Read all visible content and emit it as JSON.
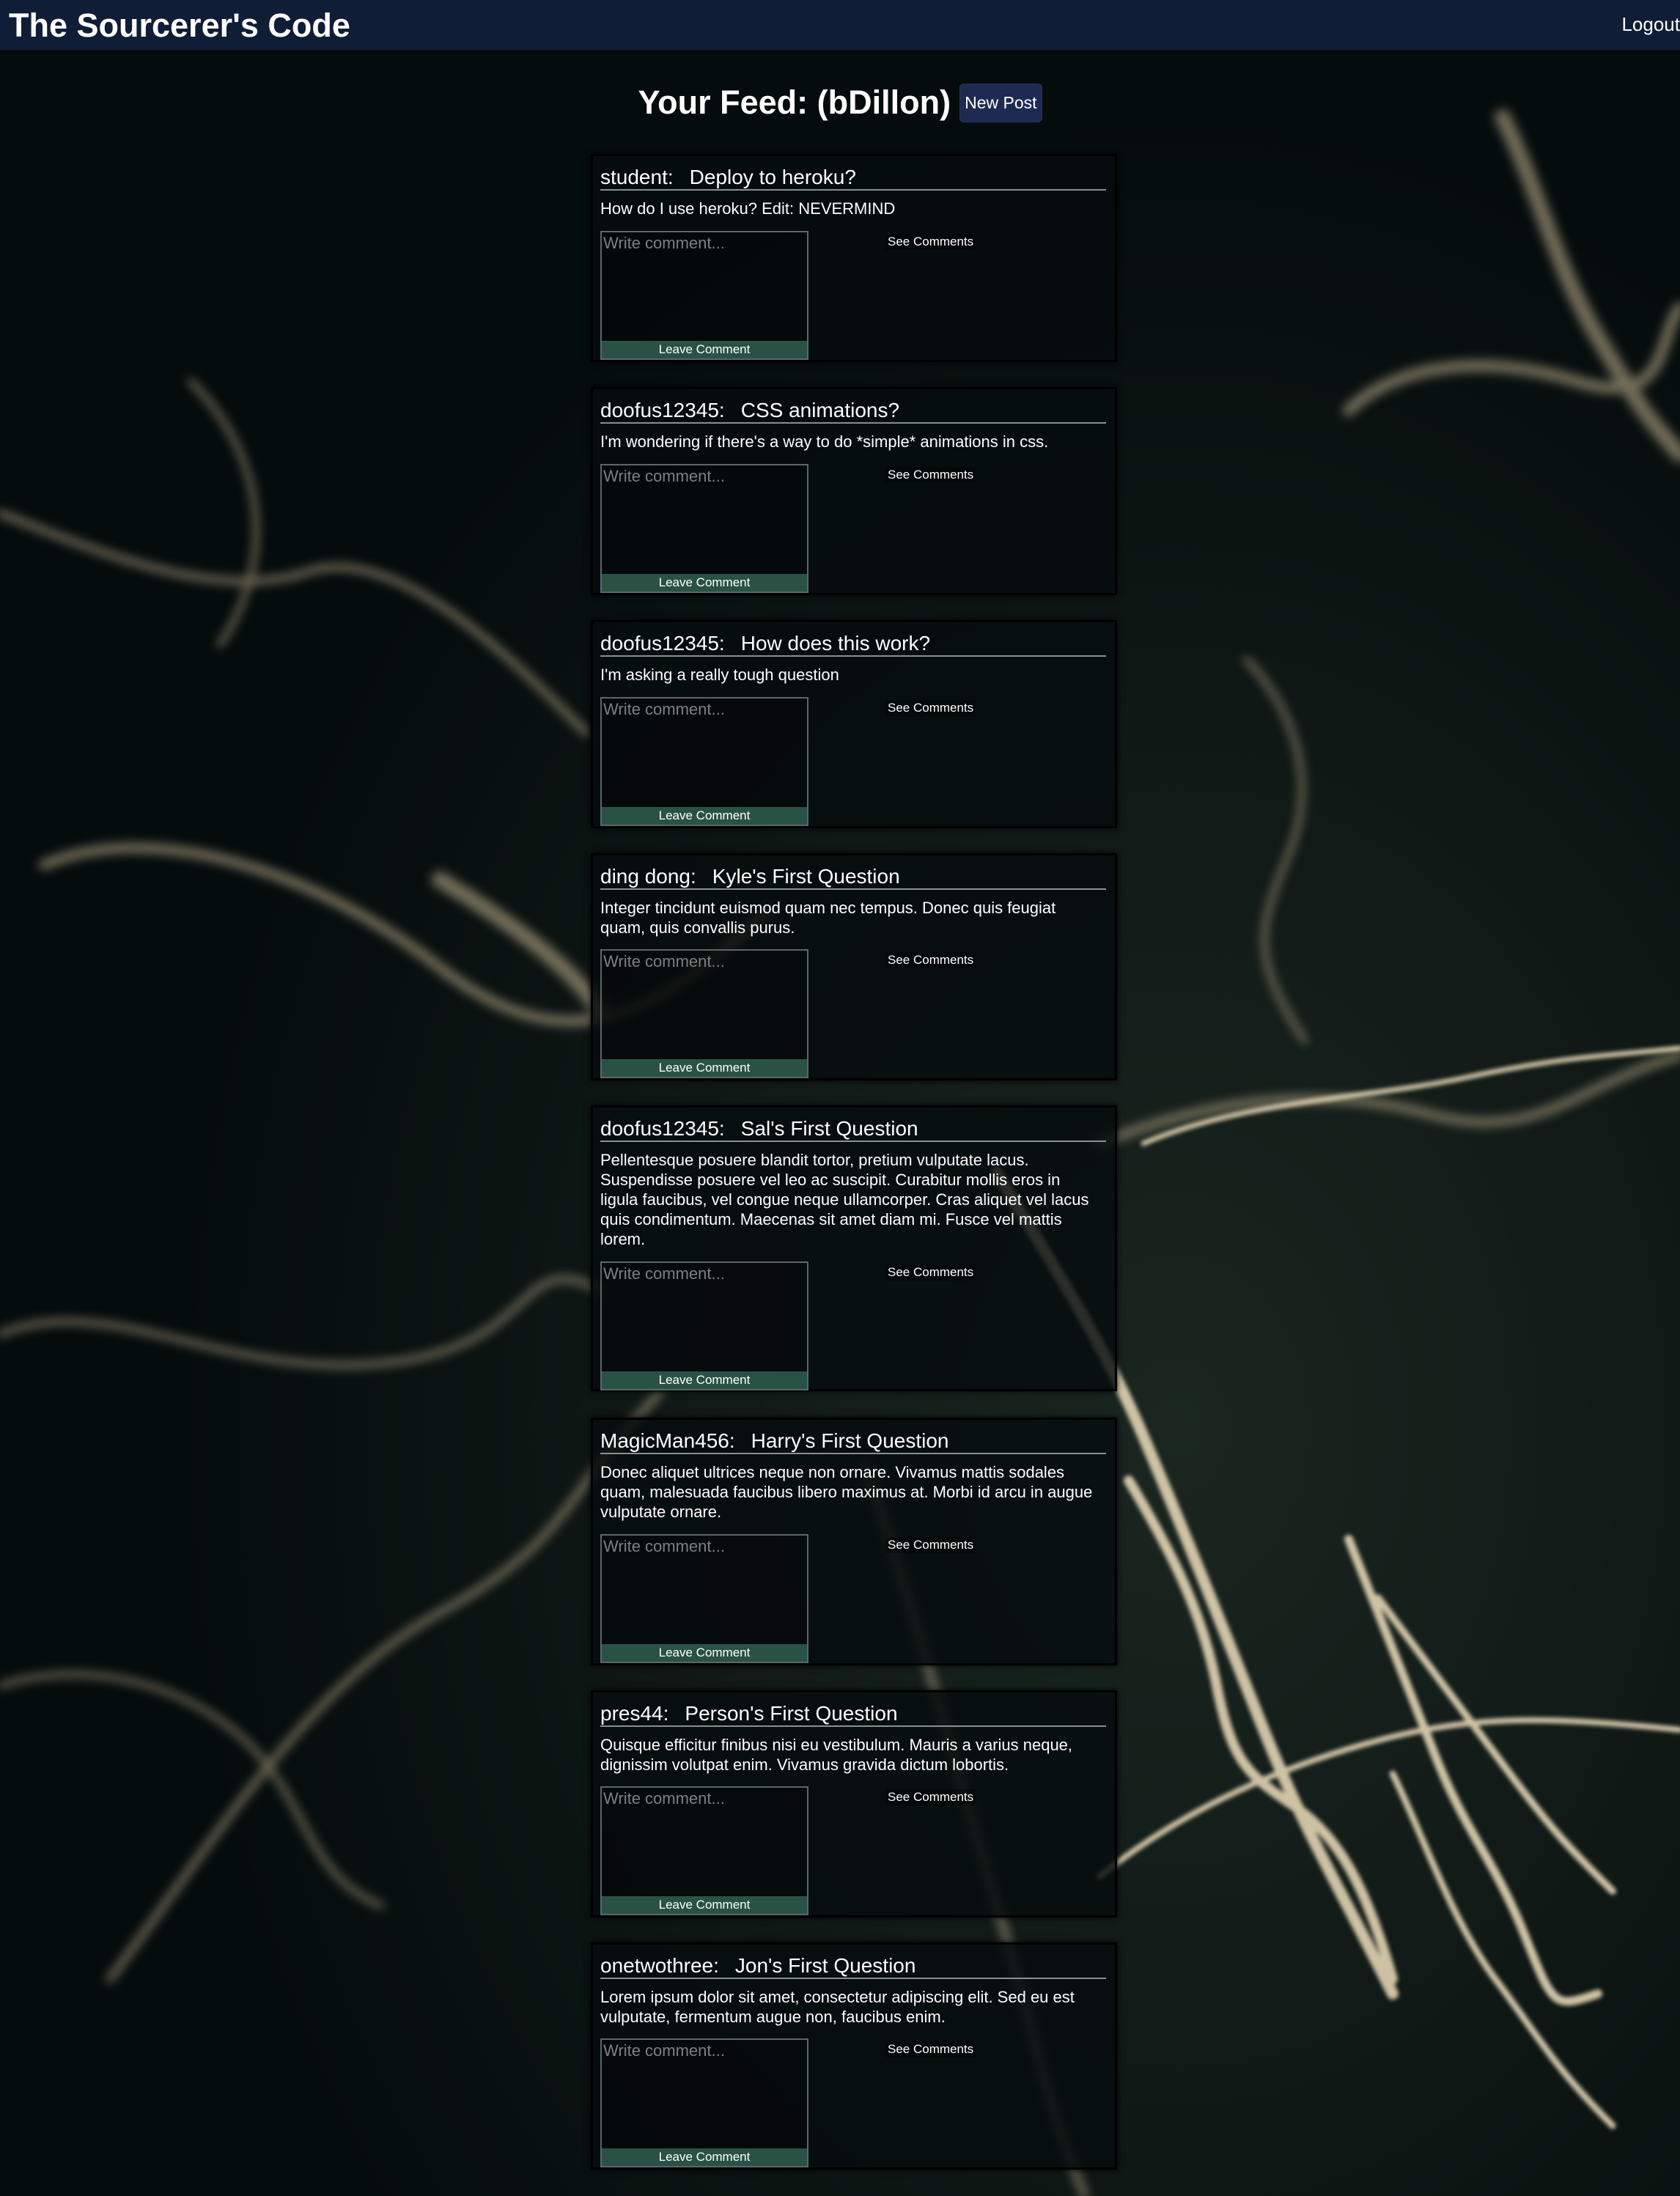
{
  "header": {
    "site_title": "The Sourcerer's Code",
    "logout_label": "Logout"
  },
  "feed": {
    "title": "Your Feed: (bDillon)",
    "new_post_label": "New Post"
  },
  "comment_placeholder": "Write comment...",
  "leave_comment_label": "Leave Comment",
  "see_comments_label": "See Comments",
  "posts": [
    {
      "author": "student:",
      "title": "Deploy to heroku?",
      "body": "How do I use heroku? Edit: NEVERMIND"
    },
    {
      "author": "doofus12345:",
      "title": "CSS animations?",
      "body": "I'm wondering if there's a way to do *simple* animations in css."
    },
    {
      "author": "doofus12345:",
      "title": "How does this work?",
      "body": "I'm asking a really tough question"
    },
    {
      "author": "ding dong:",
      "title": "Kyle's First Question",
      "body": "Integer tincidunt euismod quam nec tempus. Donec quis feugiat quam, quis convallis purus."
    },
    {
      "author": "doofus12345:",
      "title": "Sal's First Question",
      "body": "Pellentesque posuere blandit tortor, pretium vulputate lacus. Suspendisse posuere vel leo ac suscipit. Curabitur mollis eros in ligula faucibus, vel congue neque ullamcorper. Cras aliquet vel lacus quis condimentum. Maecenas sit amet diam mi. Fusce vel mattis lorem."
    },
    {
      "author": "MagicMan456:",
      "title": "Harry's First Question",
      "body": "Donec aliquet ultrices neque non ornare. Vivamus mattis sodales quam, malesuada faucibus libero maximus at. Morbi id arcu in augue vulputate ornare."
    },
    {
      "author": "pres44:",
      "title": "Person's First Question",
      "body": "Quisque efficitur finibus nisi eu vestibulum. Mauris a varius neque, dignissim volutpat enim. Vivamus gravida dictum lobortis."
    },
    {
      "author": "onetwothree:",
      "title": "Jon's First Question",
      "body": "Lorem ipsum dolor sit amet, consectetur adipiscing elit. Sed eu est vulputate, fermentum augue non, faucibus enim."
    }
  ],
  "colors": {
    "background": "#07100f",
    "topbar": "#101d36",
    "new_post_button": "#1f2a52",
    "leave_comment_button": "#295245",
    "light_streaks": "#d9c9a8"
  }
}
